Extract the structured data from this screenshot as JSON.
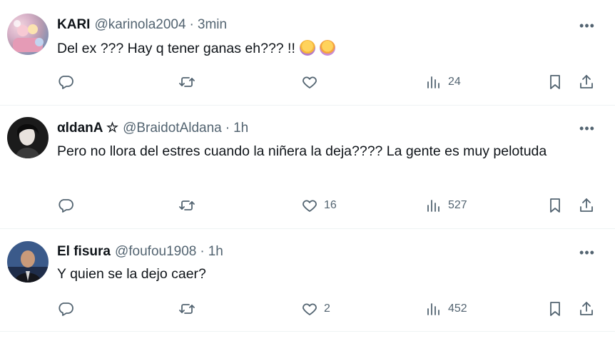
{
  "replies": [
    {
      "display_name": "KARI",
      "handle": "@karinola2004",
      "time": "3min",
      "text": "Del ex ??? Hay q tener ganas eh??? !!",
      "emojis": [
        "woman-facepalming",
        "woman-shrugging"
      ],
      "reply_count": "",
      "retweet_count": "",
      "like_count": "",
      "view_count": "24"
    },
    {
      "display_name": "αldanA ☆",
      "handle": "@BraidotAldana",
      "time": "1h",
      "text": "Pero no llora del estres cuando la niñera la deja???? La gente es muy pelotuda",
      "reply_count": "",
      "retweet_count": "",
      "like_count": "16",
      "view_count": "527"
    },
    {
      "display_name": "El fisura",
      "handle": "@foufou1908",
      "time": "1h",
      "text": "Y quien se la dejo caer?",
      "reply_count": "",
      "retweet_count": "",
      "like_count": "2",
      "view_count": "452"
    }
  ],
  "separator": "·",
  "more_label": "•••",
  "icons": {
    "reply": "reply-icon",
    "retweet": "retweet-icon",
    "like": "heart-icon",
    "views": "views-icon",
    "bookmark": "bookmark-icon",
    "share": "share-icon"
  },
  "colors": {
    "text": "#0f1419",
    "secondary": "#536471",
    "border": "#eff3f4"
  }
}
